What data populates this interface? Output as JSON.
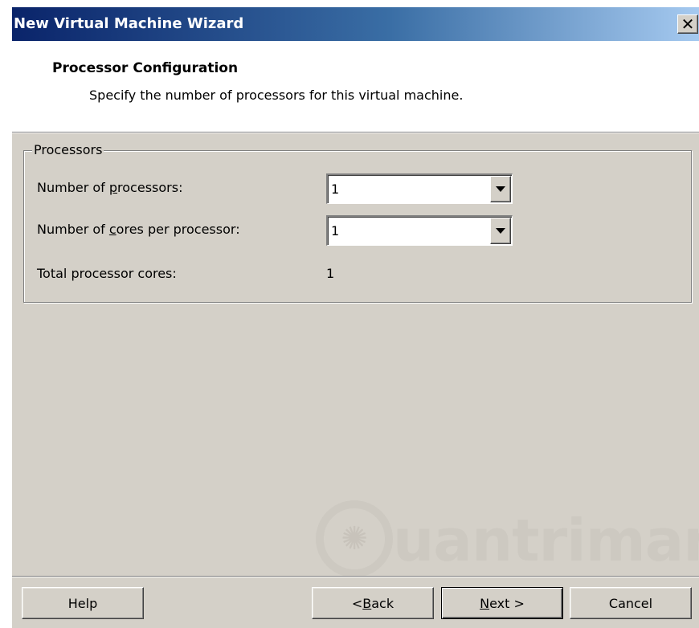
{
  "window": {
    "title": "New Virtual Machine Wizard",
    "close_glyph": "✕"
  },
  "header": {
    "heading": "Processor Configuration",
    "subheading": "Specify the number of processors for this virtual machine."
  },
  "processors_group": {
    "legend": "Processors",
    "num_processors": {
      "label_prefix": "Number of ",
      "label_accel": "p",
      "label_suffix": "rocessors:",
      "value": "1"
    },
    "cores_per_processor": {
      "label_prefix": "Number of ",
      "label_accel": "c",
      "label_suffix": "ores per processor:",
      "value": "1"
    },
    "total_cores": {
      "label": "Total processor cores:",
      "value": "1"
    }
  },
  "watermark": {
    "text": "uantrimang"
  },
  "buttons": {
    "help": "Help",
    "back_prefix": "< ",
    "back_accel": "B",
    "back_suffix": "ack",
    "next_accel": "N",
    "next_suffix": "ext >",
    "cancel": "Cancel"
  },
  "icons": {
    "close": "close-icon",
    "dropdown": "chevron-down-icon",
    "watermark_logo": "lightbulb-icon"
  }
}
